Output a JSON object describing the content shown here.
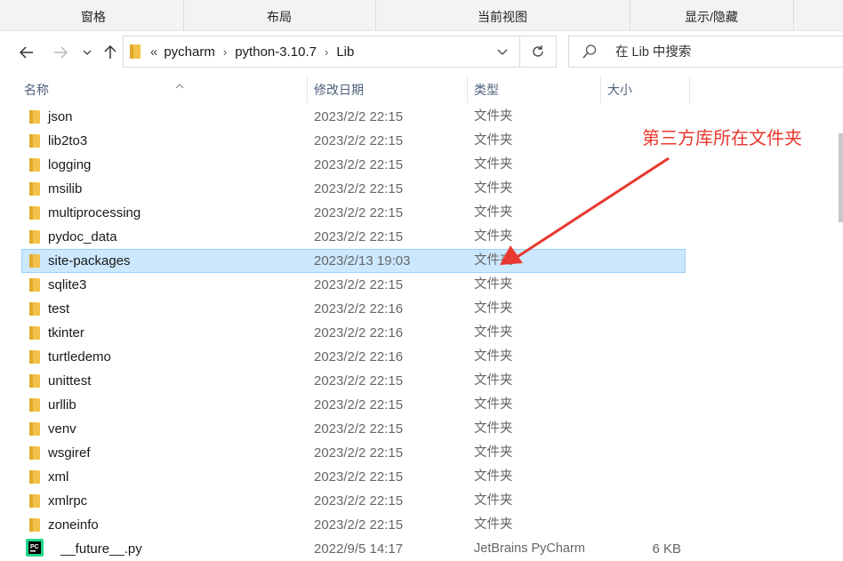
{
  "ribbon": {
    "groups": [
      "窗格",
      "布局",
      "当前视图",
      "显示/隐藏"
    ]
  },
  "address_bar": {
    "overflow_marker": "«",
    "breadcrumbs": [
      "pycharm",
      "python-3.10.7",
      "Lib"
    ]
  },
  "search": {
    "placeholder": "在 Lib 中搜索"
  },
  "columns": {
    "name": "名称",
    "date": "修改日期",
    "type": "类型",
    "size": "大小"
  },
  "files": [
    {
      "name": "json",
      "date": "2023/2/2 22:15",
      "type": "文件夹",
      "size": "",
      "kind": "folder"
    },
    {
      "name": "lib2to3",
      "date": "2023/2/2 22:15",
      "type": "文件夹",
      "size": "",
      "kind": "folder"
    },
    {
      "name": "logging",
      "date": "2023/2/2 22:15",
      "type": "文件夹",
      "size": "",
      "kind": "folder"
    },
    {
      "name": "msilib",
      "date": "2023/2/2 22:15",
      "type": "文件夹",
      "size": "",
      "kind": "folder"
    },
    {
      "name": "multiprocessing",
      "date": "2023/2/2 22:15",
      "type": "文件夹",
      "size": "",
      "kind": "folder"
    },
    {
      "name": "pydoc_data",
      "date": "2023/2/2 22:15",
      "type": "文件夹",
      "size": "",
      "kind": "folder"
    },
    {
      "name": "site-packages",
      "date": "2023/2/13 19:03",
      "type": "文件夹",
      "size": "",
      "kind": "folder",
      "selected": true
    },
    {
      "name": "sqlite3",
      "date": "2023/2/2 22:15",
      "type": "文件夹",
      "size": "",
      "kind": "folder"
    },
    {
      "name": "test",
      "date": "2023/2/2 22:16",
      "type": "文件夹",
      "size": "",
      "kind": "folder"
    },
    {
      "name": "tkinter",
      "date": "2023/2/2 22:16",
      "type": "文件夹",
      "size": "",
      "kind": "folder"
    },
    {
      "name": "turtledemo",
      "date": "2023/2/2 22:16",
      "type": "文件夹",
      "size": "",
      "kind": "folder"
    },
    {
      "name": "unittest",
      "date": "2023/2/2 22:15",
      "type": "文件夹",
      "size": "",
      "kind": "folder"
    },
    {
      "name": "urllib",
      "date": "2023/2/2 22:15",
      "type": "文件夹",
      "size": "",
      "kind": "folder"
    },
    {
      "name": "venv",
      "date": "2023/2/2 22:15",
      "type": "文件夹",
      "size": "",
      "kind": "folder"
    },
    {
      "name": "wsgiref",
      "date": "2023/2/2 22:15",
      "type": "文件夹",
      "size": "",
      "kind": "folder"
    },
    {
      "name": "xml",
      "date": "2023/2/2 22:15",
      "type": "文件夹",
      "size": "",
      "kind": "folder"
    },
    {
      "name": "xmlrpc",
      "date": "2023/2/2 22:15",
      "type": "文件夹",
      "size": "",
      "kind": "folder"
    },
    {
      "name": "zoneinfo",
      "date": "2023/2/2 22:15",
      "type": "文件夹",
      "size": "",
      "kind": "folder"
    },
    {
      "name": "__future__.py",
      "date": "2022/9/5 14:17",
      "type": "JetBrains PyCharm",
      "size": "6 KB",
      "kind": "pycharm-file"
    }
  ],
  "annotation": {
    "text": "第三方库所在文件夹",
    "color": "#e8382f"
  },
  "colors": {
    "selection_bg": "#cce8ff",
    "selection_border": "#99d1ff",
    "folder": "#f3c24a"
  }
}
